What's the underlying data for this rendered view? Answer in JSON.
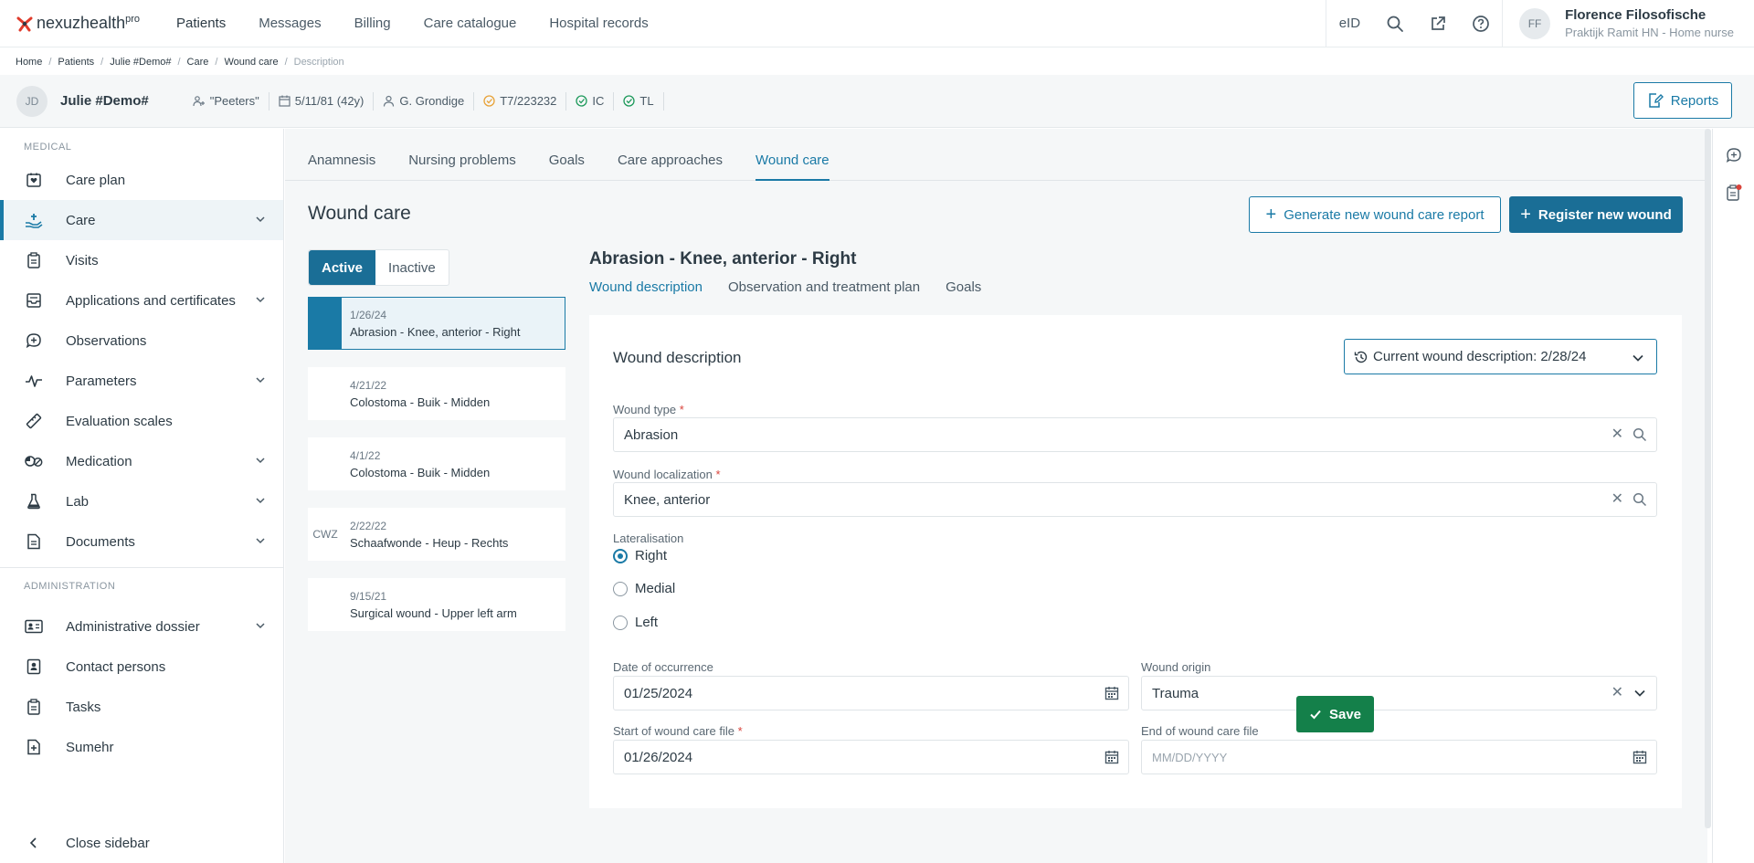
{
  "brand": {
    "name": "nexuzhealth",
    "suffix": "pro",
    "accent": "#1a7aa6",
    "logo_color": "#e03b2b"
  },
  "topnav": [
    "Patients",
    "Messages",
    "Billing",
    "Care catalogue",
    "Hospital records"
  ],
  "top_right": {
    "eid": "eID",
    "icons": [
      "search-icon",
      "external-link-icon",
      "help-icon"
    ]
  },
  "user": {
    "initials": "FF",
    "name": "Florence Filosofische",
    "role": "Praktijk Ramit HN - Home nurse"
  },
  "breadcrumb": [
    "Home",
    "Patients",
    "Julie #Demo#",
    "Care",
    "Wound care",
    "Description"
  ],
  "patient": {
    "initials": "JD",
    "name": "Julie #Demo#",
    "chips": [
      {
        "icon": "family-icon",
        "text": "\"Peeters\""
      },
      {
        "icon": "calendar-icon",
        "text": "5/11/81 (42y)"
      },
      {
        "icon": "person-icon",
        "text": "G. Grondige"
      },
      {
        "icon": "pending-check-icon",
        "text": "T7/223232"
      },
      {
        "icon": "check-circle-icon",
        "text": "IC"
      },
      {
        "icon": "check-circle-icon",
        "text": "TL"
      }
    ],
    "reports_label": "Reports"
  },
  "sidebar": {
    "medical_label": "MEDICAL",
    "admin_label": "ADMINISTRATION",
    "medical_items": [
      {
        "label": "Care plan",
        "icon": "care-plan-icon",
        "chevron": false,
        "active": false
      },
      {
        "label": "Care",
        "icon": "care-hand-icon",
        "chevron": true,
        "active": true
      },
      {
        "label": "Visits",
        "icon": "clipboard-icon",
        "chevron": false,
        "active": false
      },
      {
        "label": "Applications and certificates",
        "icon": "inbox-icon",
        "chevron": true,
        "active": false
      },
      {
        "label": "Observations",
        "icon": "chat-plus-icon",
        "chevron": false,
        "active": false
      },
      {
        "label": "Parameters",
        "icon": "pulse-icon",
        "chevron": true,
        "active": false
      },
      {
        "label": "Evaluation scales",
        "icon": "ruler-icon",
        "chevron": false,
        "active": false
      },
      {
        "label": "Medication",
        "icon": "pills-icon",
        "chevron": true,
        "active": false
      },
      {
        "label": "Lab",
        "icon": "flask-icon",
        "chevron": true,
        "active": false
      },
      {
        "label": "Documents",
        "icon": "document-icon",
        "chevron": true,
        "active": false
      }
    ],
    "admin_items": [
      {
        "label": "Administrative dossier",
        "icon": "id-card-icon",
        "chevron": true
      },
      {
        "label": "Contact persons",
        "icon": "contact-icon",
        "chevron": false
      },
      {
        "label": "Tasks",
        "icon": "tasks-icon",
        "chevron": false
      },
      {
        "label": "Sumehr",
        "icon": "file-plus-icon",
        "chevron": false
      }
    ],
    "close_label": "Close sidebar"
  },
  "tabs": [
    "Anamnesis",
    "Nursing problems",
    "Goals",
    "Care approaches",
    "Wound care"
  ],
  "active_tab": "Wound care",
  "page_title": "Wound care",
  "actions": {
    "generate_report": "Generate new wound care report",
    "register_wound": "Register new wound"
  },
  "status_toggle": {
    "active": "Active",
    "inactive": "Inactive"
  },
  "wounds": [
    {
      "date": "1/26/24",
      "name": "Abrasion - Knee, anterior - Right",
      "badge": "",
      "selected": true
    },
    {
      "date": "4/21/22",
      "name": "Colostoma - Buik - Midden",
      "badge": "",
      "selected": false
    },
    {
      "date": "4/1/22",
      "name": "Colostoma - Buik - Midden",
      "badge": "",
      "selected": false
    },
    {
      "date": "2/22/22",
      "name": "Schaafwonde - Heup - Rechts",
      "badge": "CWZ",
      "selected": false
    },
    {
      "date": "9/15/21",
      "name": "Surgical wound - Upper left arm",
      "badge": "",
      "selected": false
    }
  ],
  "wound_detail": {
    "title": "Abrasion - Knee, anterior - Right",
    "subtabs": [
      "Wound description",
      "Observation and treatment plan",
      "Goals"
    ],
    "card_title": "Wound description",
    "current_description": "Current wound description: 2/28/24",
    "wound_type": {
      "label": "Wound type",
      "value": "Abrasion"
    },
    "wound_localization": {
      "label": "Wound localization",
      "value": "Knee, anterior"
    },
    "lateralisation": {
      "label": "Lateralisation",
      "options": [
        "Right",
        "Medial",
        "Left"
      ],
      "selected": "Right"
    },
    "date_of_occurrence": {
      "label": "Date of occurrence",
      "value": "01/25/2024"
    },
    "wound_origin": {
      "label": "Wound origin",
      "value": "Trauma"
    },
    "start_file": {
      "label": "Start of wound care file",
      "value": "01/26/2024"
    },
    "end_file": {
      "label": "End of wound care file",
      "placeholder": "MM/DD/YYYY"
    },
    "required_mark": "*",
    "save_label": "Save"
  },
  "colors": {
    "primary": "#1a6e96",
    "save": "#14804a",
    "required": "#d9433b",
    "background": "#f5f7f8"
  }
}
